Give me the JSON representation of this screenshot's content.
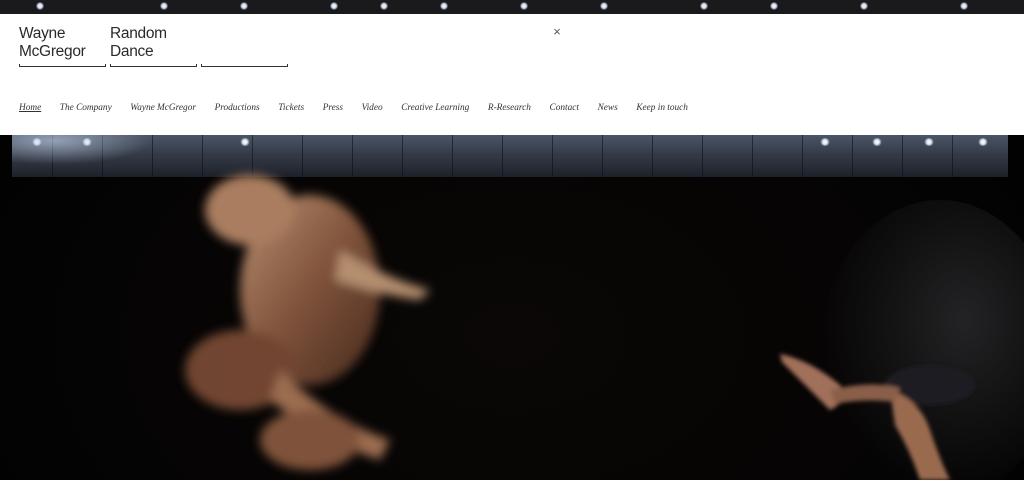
{
  "header": {
    "logo": {
      "wayne_line1": "Wayne",
      "wayne_line2": "McGregor",
      "random_line1": "Random",
      "random_line2": "Dance"
    },
    "close_label": "×"
  },
  "nav": {
    "active_index": 0,
    "items": [
      "Home",
      "The Company",
      "Wayne McGregor",
      "Productions",
      "Tickets",
      "Press",
      "Video",
      "Creative Learning",
      "R-Research",
      "Contact",
      "News",
      "Keep in touch"
    ]
  },
  "colors": {
    "header_bg": "#ffffff",
    "text": "#333333",
    "stage_bg": "#000000"
  },
  "icons": {
    "close": "close-icon"
  }
}
